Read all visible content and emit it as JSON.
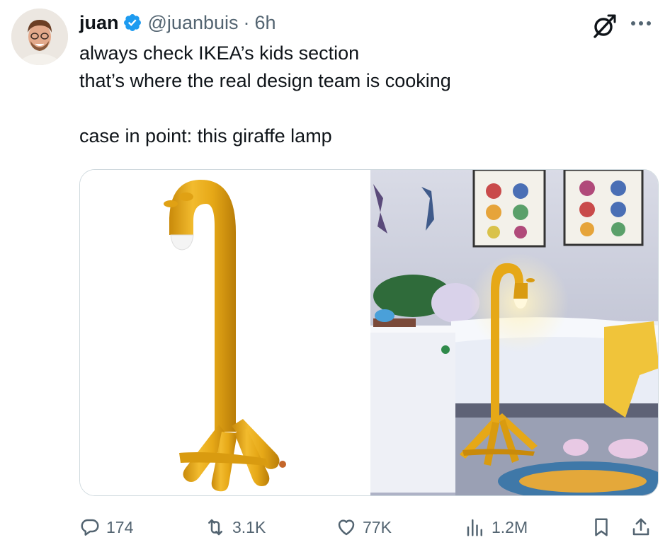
{
  "author": {
    "display_name": "juan",
    "handle": "@juanbuis",
    "separator": "·",
    "time": "6h",
    "verified": true
  },
  "tweet": {
    "lines": [
      "always check IKEA’s kids section",
      "that’s where the real design team is cooking",
      "case in point: this giraffe lamp"
    ]
  },
  "media": {
    "images": [
      "giraffe-lamp-product-photo",
      "giraffe-lamp-bedroom-photo"
    ]
  },
  "actions": {
    "replies": "174",
    "reposts": "3.1K",
    "likes": "77K",
    "views": "1.2M"
  },
  "colors": {
    "text": "#0f1419",
    "secondary": "#536471",
    "verified": "#1d9bf0",
    "border": "#cfd9de",
    "lamp": "#e6a817"
  },
  "icons": [
    "verified-badge-icon",
    "grok-icon",
    "more-icon",
    "reply-icon",
    "repost-icon",
    "like-icon",
    "views-icon",
    "bookmark-icon",
    "share-icon"
  ]
}
